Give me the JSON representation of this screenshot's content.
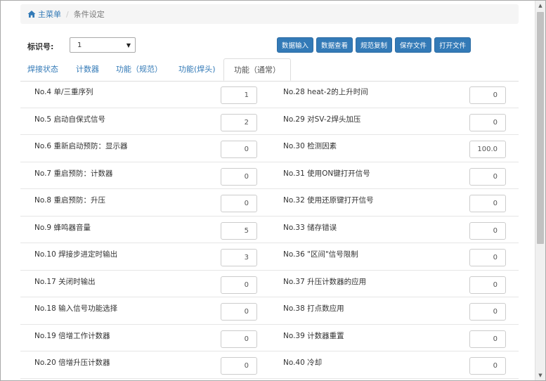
{
  "breadcrumb": {
    "home_label": "主菜单",
    "separator": "/",
    "current": "条件设定"
  },
  "id_field": {
    "label": "标识号:",
    "selected": "1"
  },
  "toolbar": {
    "buttons": [
      {
        "label": "数据输入"
      },
      {
        "label": "数据查看"
      },
      {
        "label": "规范复制"
      },
      {
        "label": "保存文件"
      },
      {
        "label": "打开文件"
      }
    ]
  },
  "tabs": [
    {
      "label": "焊接状态"
    },
    {
      "label": "计数器"
    },
    {
      "label": "功能（规范）"
    },
    {
      "label": "功能(焊头)"
    },
    {
      "label": "功能（通常）",
      "active": true
    }
  ],
  "rows": [
    {
      "left_label": "No.4 单/三重序列",
      "left_value": "1",
      "right_label": "No.28 heat-2的上升时间",
      "right_value": "0"
    },
    {
      "left_label": "No.5 启动自保式信号",
      "left_value": "2",
      "right_label": "No.29 对SV-2焊头加压",
      "right_value": "0"
    },
    {
      "left_label": "No.6 重新启动预防：显示器",
      "left_value": "0",
      "right_label": "No.30 检测因素",
      "right_value": "100.0"
    },
    {
      "left_label": "No.7 重启预防：计数器",
      "left_value": "0",
      "right_label": "No.31 使用ON键打开信号",
      "right_value": "0"
    },
    {
      "left_label": "No.8 重启预防：升压",
      "left_value": "0",
      "right_label": "No.32 使用还原键打开信号",
      "right_value": "0"
    },
    {
      "left_label": "No.9 蜂鸣器音量",
      "left_value": "5",
      "right_label": "No.33 储存错误",
      "right_value": "0"
    },
    {
      "left_label": "No.10 焊接步进定时输出",
      "left_value": "3",
      "right_label": "No.36 \"区间\"信号限制",
      "right_value": "0"
    },
    {
      "left_label": "No.17 关闭时输出",
      "left_value": "0",
      "right_label": "No.37 升压计数器的应用",
      "right_value": "0"
    },
    {
      "left_label": "No.18 输入信号功能选择",
      "left_value": "0",
      "right_label": "No.38 打点数应用",
      "right_value": "0"
    },
    {
      "left_label": "No.19 倍增工作计数器",
      "left_value": "0",
      "right_label": "No.39 计数器重置",
      "right_value": "0"
    },
    {
      "left_label": "No.20 倍增升压计数器",
      "left_value": "0",
      "right_label": "No.40 冷却",
      "right_value": "0"
    }
  ],
  "colors": {
    "primary": "#337ab7",
    "breadcrumb_bg": "#f5f5f5",
    "border": "#dddddd"
  }
}
